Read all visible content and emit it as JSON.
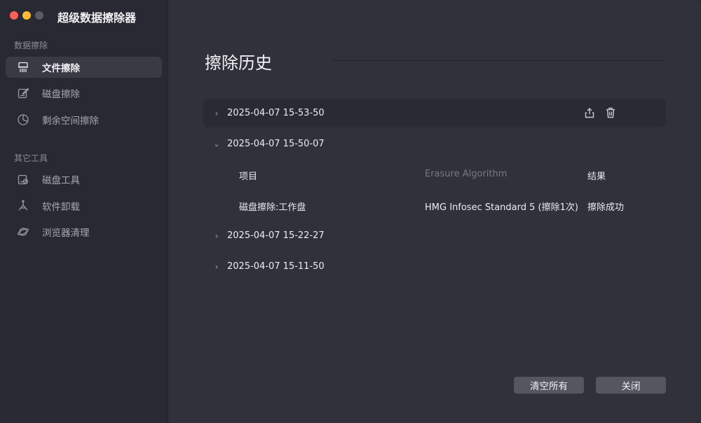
{
  "app": {
    "title": "超级数据擦除器"
  },
  "sidebar": {
    "sections": [
      {
        "label": "数据擦除"
      },
      {
        "label": "其它工具"
      }
    ],
    "items": [
      {
        "label": "文件擦除",
        "icon": "shredder-icon",
        "active": true
      },
      {
        "label": "磁盘擦除",
        "icon": "disk-erase-icon"
      },
      {
        "label": "剩余空间擦除",
        "icon": "pie-chart-icon"
      },
      {
        "label": "磁盘工具",
        "icon": "disk-tool-icon"
      },
      {
        "label": "软件卸载",
        "icon": "uninstall-icon"
      },
      {
        "label": "浏览器清理",
        "icon": "planet-icon"
      }
    ]
  },
  "main": {
    "title": "擦除历史",
    "history": [
      {
        "date": "2025-04-07 15-53-50",
        "expanded": false
      },
      {
        "date": "2025-04-07 15-50-07",
        "expanded": true
      },
      {
        "date": "2025-04-07 15-22-27",
        "expanded": false
      },
      {
        "date": "2025-04-07 15-11-50",
        "expanded": false
      }
    ],
    "details": {
      "headers": {
        "item": "项目",
        "algorithm": "Erasure Algorithm",
        "result": "结果"
      },
      "rows": [
        {
          "item": "磁盘擦除:工作盘",
          "algorithm": "HMG Infosec Standard 5 (擦除1次)",
          "result": "擦除成功"
        }
      ]
    },
    "buttons": {
      "clear_all": "清空所有",
      "close": "关闭"
    }
  },
  "colors": {
    "accent_red": "#fe5f57",
    "accent_yellow": "#febc2e",
    "button_bg": "#565661"
  }
}
